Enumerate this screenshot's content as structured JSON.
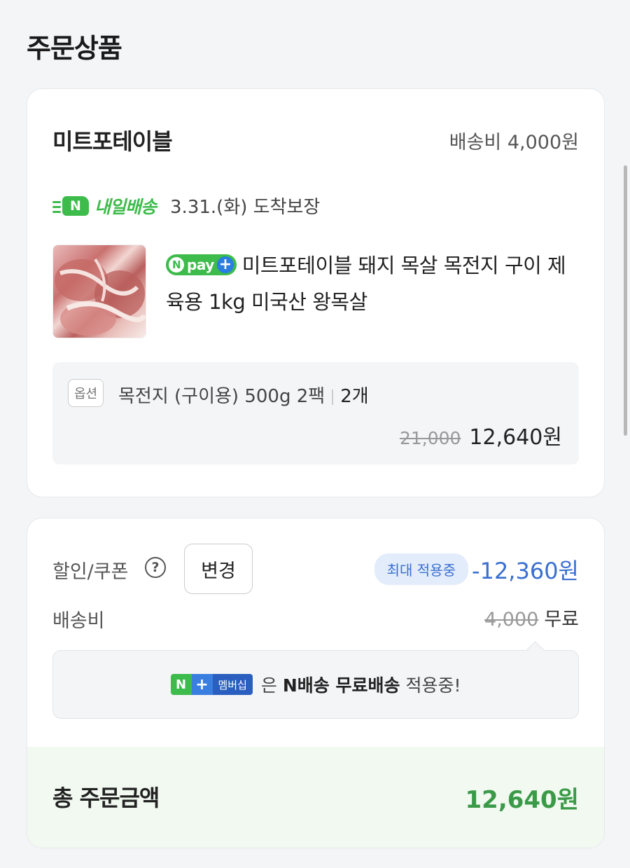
{
  "section_title": "주문상품",
  "store": {
    "name": "미트포테이블",
    "shipping_fee": "배송비 4,000원"
  },
  "delivery": {
    "badge_letter": "N",
    "label": "내일배송",
    "date_text": "3.31.(화) 도착보장"
  },
  "product": {
    "npay_n": "N",
    "npay_text": "pay",
    "npay_plus": "+",
    "name": "미트포테이블 돼지 목살 목전지 구이 제육용 1kg 미국산 왕목살"
  },
  "option": {
    "tag": "옵션",
    "text": "목전지 (구이용) 500g 2팩",
    "quantity": "2개",
    "original_price": "21,000",
    "final_price": "12,640원"
  },
  "discount": {
    "label": "할인/쿠폰",
    "help": "?",
    "change_button": "변경",
    "badge": "최대 적용중",
    "amount": "-12,360원"
  },
  "shipping": {
    "label": "배송비",
    "original": "4,000",
    "free": "무료"
  },
  "membership": {
    "logo_n": "N",
    "logo_plus": "+",
    "logo_text": "멤버십",
    "text_pre": "은",
    "text_bold": "N배송 무료배송",
    "text_post": "적용중!"
  },
  "total": {
    "label": "총 주문금액",
    "amount": "12,640원"
  },
  "colors": {
    "naver_green": "#3dbb4b",
    "discount_blue": "#3a6fd0",
    "total_green": "#3a9a48"
  }
}
